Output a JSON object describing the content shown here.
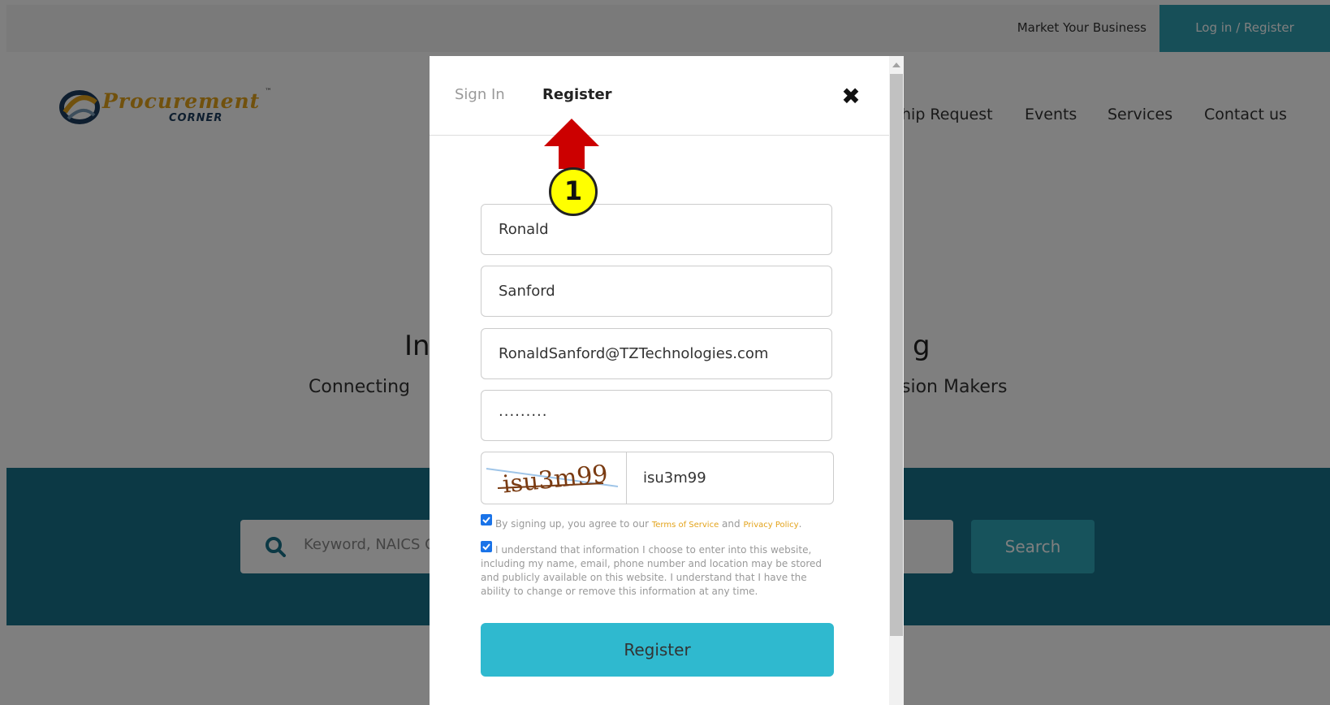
{
  "topbar": {
    "market_label": "Market Your Business",
    "login_label": "Log in / Register"
  },
  "logo": {
    "word": "Procurement",
    "sub": "CORNER",
    "tm": "™"
  },
  "nav": {
    "items": [
      "hip Request",
      "Events",
      "Services",
      "Contact us"
    ]
  },
  "hero": {
    "title_left": "In",
    "title_right": "g",
    "sub_left": "Connecting",
    "sub_right": "sion Makers"
  },
  "search": {
    "placeholder": "Keyword, NAICS C",
    "button_label": "Search"
  },
  "modal": {
    "tabs": {
      "signin": "Sign In",
      "register": "Register"
    },
    "close_label": "✖",
    "first_name": "Ronald",
    "last_name": "Sanford",
    "email": "RonaldSanford@TZTechnologies.com",
    "password": "·········",
    "captcha_image_text": "isu3m99",
    "captcha_value": "isu3m99",
    "agree": {
      "prefix": "By signing up, you agree to our ",
      "terms": "Terms of Service",
      "and": " and ",
      "privacy": "Privacy Policy",
      "suffix": "."
    },
    "consent_text": "I understand that information I choose to enter into this website, including my name, email, phone number and location may be stored and publicly available on this website. I understand that I have the ability to change or remove this information at any time.",
    "register_button": "Register"
  },
  "annotation": {
    "step_number": "1"
  },
  "colors": {
    "teal_dark": "#18738a",
    "teal_button": "#2fb9cf",
    "accent_orange": "#e3a31b",
    "annotation_red": "#cc0000",
    "annotation_yellow": "#ffff00"
  }
}
